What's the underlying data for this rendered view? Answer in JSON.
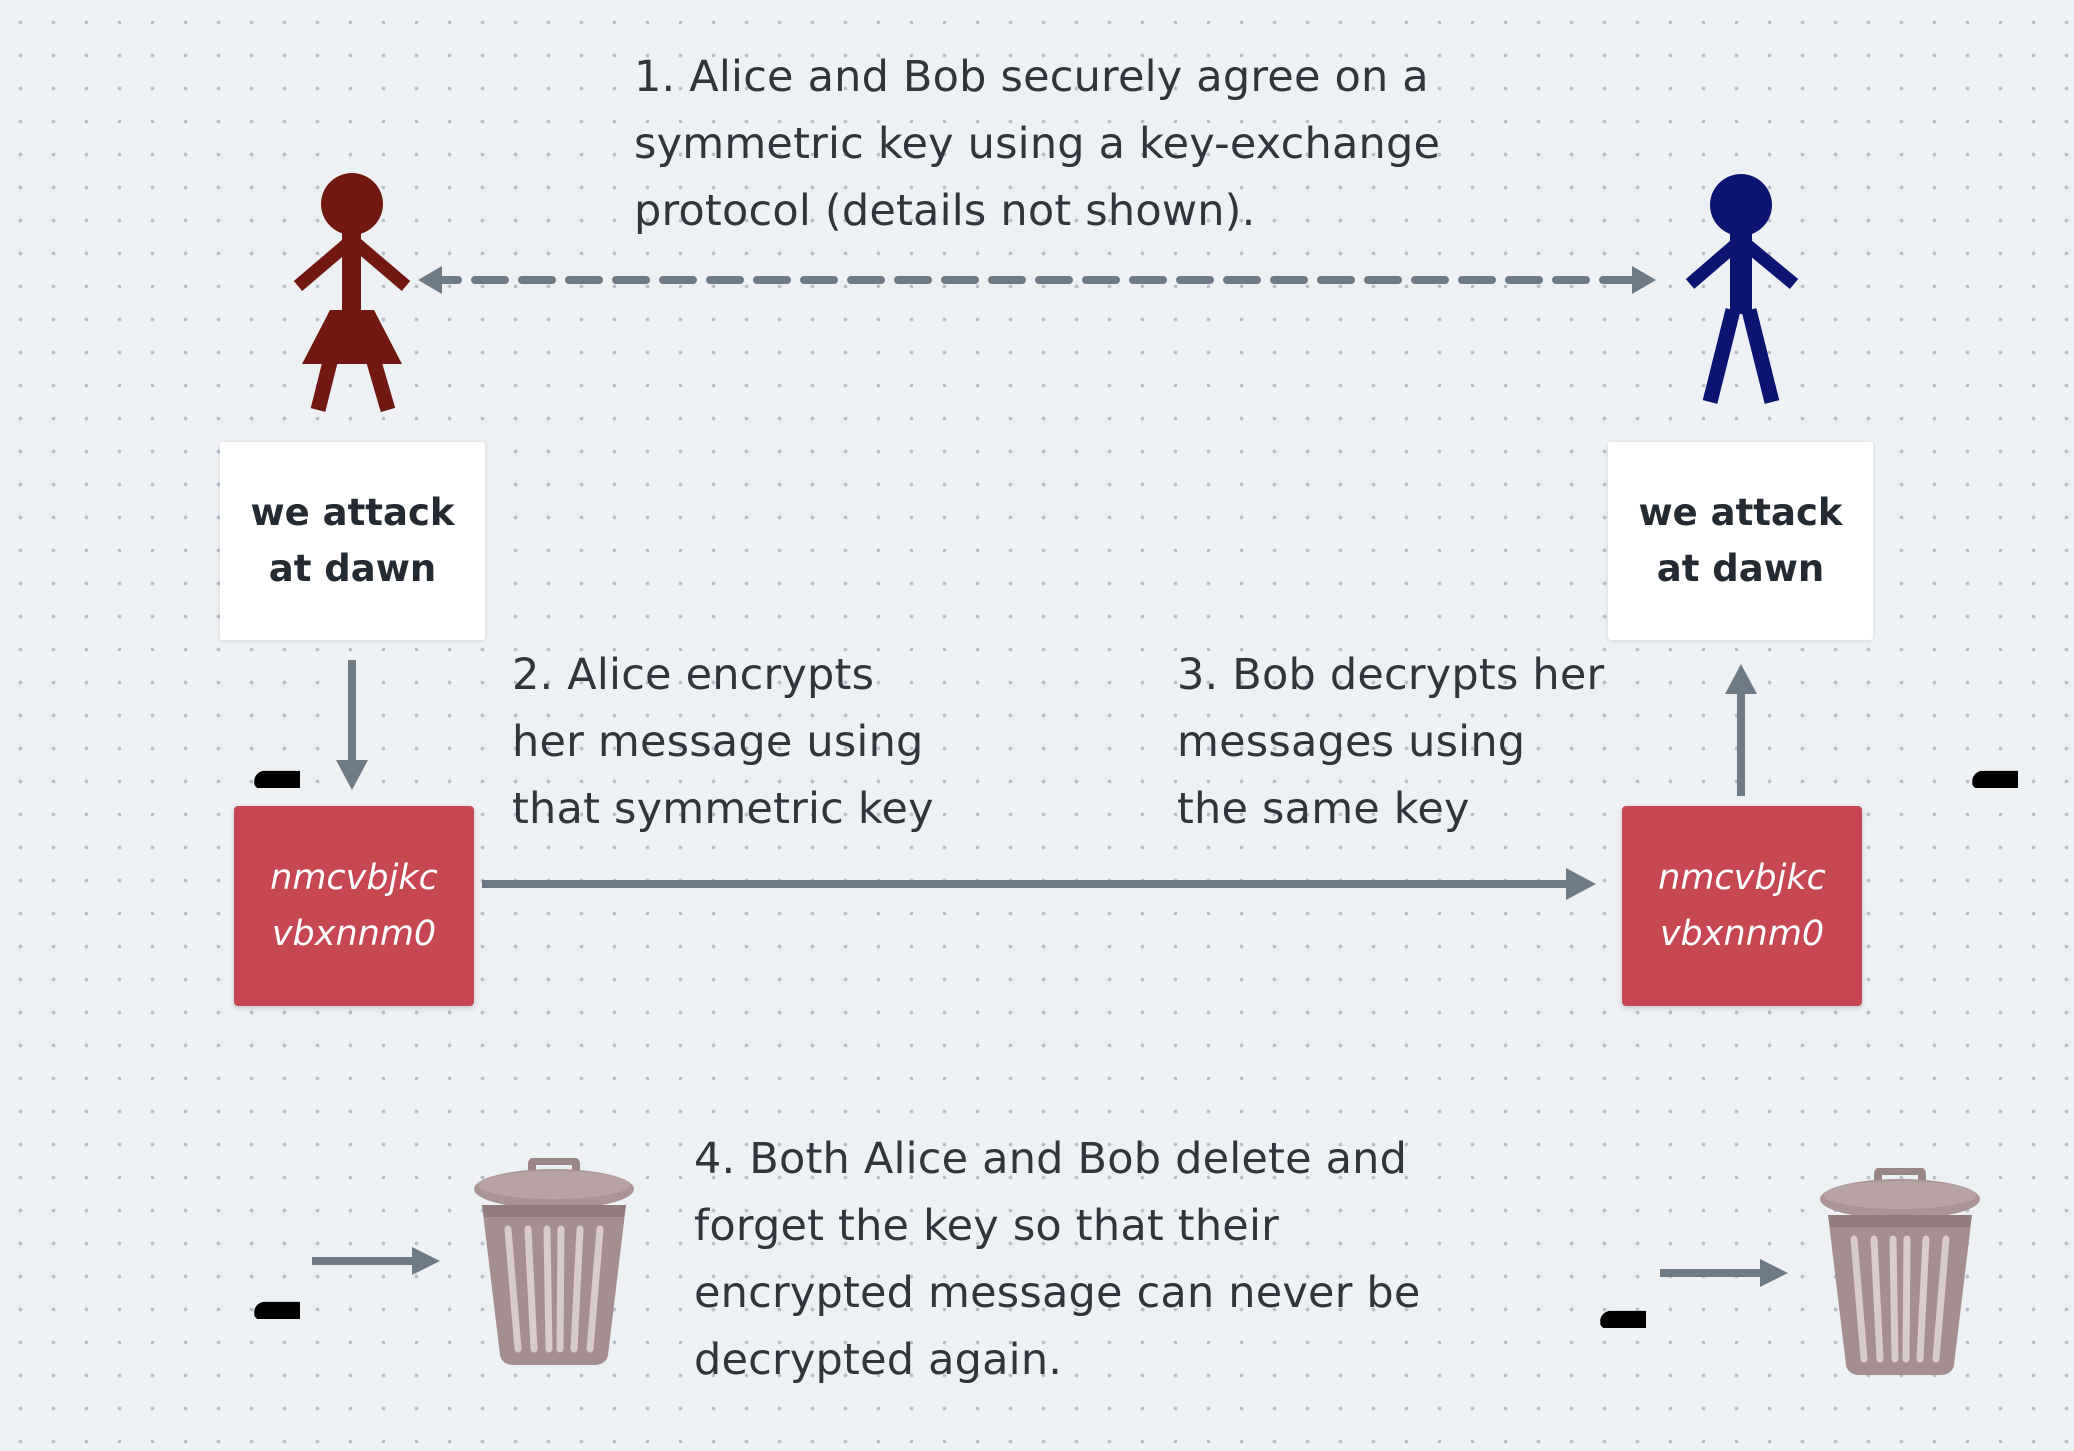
{
  "steps": {
    "step1": "1. Alice and Bob securely agree on a\nsymmetric key using a key-exchange\nprotocol (details not shown).",
    "step2": "2. Alice encrypts\nher message using\nthat symmetric key",
    "step3": "3. Bob decrypts her\nmessages using\nthe same key",
    "step4": "4. Both Alice and Bob delete and\nforget the key so that their\nencrypted message can never be\ndecrypted again."
  },
  "alice": {
    "plaintext": "we attack\nat dawn",
    "ciphertext": "nmcvbjkc\nvbxnnm0"
  },
  "bob": {
    "plaintext": "we attack\nat dawn",
    "ciphertext": "nmcvbjkc\nvbxnnm0"
  },
  "colors": {
    "alice_figure": "#721812",
    "bob_figure": "#0b1470",
    "ciphertext_card": "#c64652",
    "arrow": "#6e7b87",
    "trash_can": "#a58e8f",
    "key": "#000000"
  },
  "icons": [
    "alice-figure-icon",
    "bob-figure-icon",
    "key-icon",
    "trash-can-icon",
    "dashed-double-arrow",
    "arrow"
  ]
}
